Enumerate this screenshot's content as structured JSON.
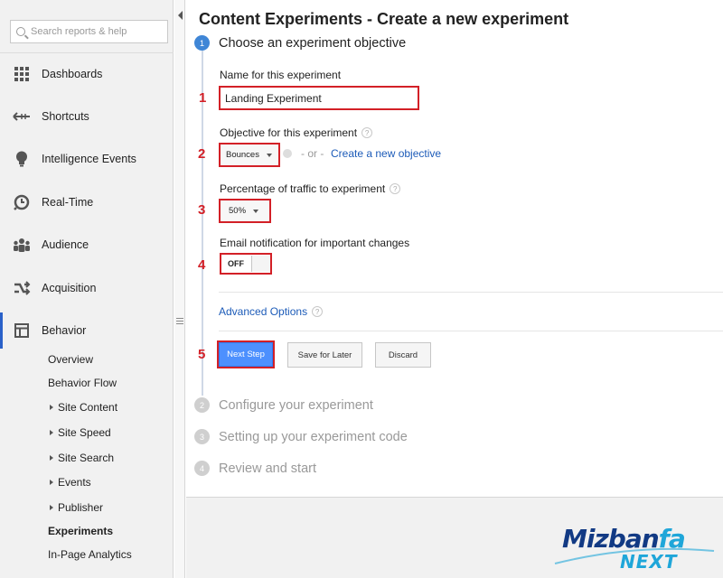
{
  "sidebar": {
    "search_placeholder": "Search reports & help",
    "nav": [
      {
        "label": "Dashboards",
        "icon": "dashboard-grid-icon"
      },
      {
        "label": "Shortcuts",
        "icon": "shortcut-arrow-icon"
      },
      {
        "label": "Intelligence Events",
        "icon": "lightbulb-icon"
      },
      {
        "label": "Real-Time",
        "icon": "realtime-clock-icon"
      },
      {
        "label": "Audience",
        "icon": "audience-people-icon"
      },
      {
        "label": "Acquisition",
        "icon": "acquisition-arrows-icon"
      },
      {
        "label": "Behavior",
        "icon": "behavior-window-icon"
      }
    ],
    "behavior_sub": [
      {
        "label": "Overview"
      },
      {
        "label": "Behavior Flow"
      },
      {
        "label": "Site Content"
      },
      {
        "label": "Site Speed"
      },
      {
        "label": "Site Search"
      },
      {
        "label": "Events"
      },
      {
        "label": "Publisher"
      },
      {
        "label": "Experiments"
      },
      {
        "label": "In-Page Analytics"
      }
    ]
  },
  "main": {
    "title": "Content Experiments - Create a new experiment",
    "steps": [
      {
        "num": "1",
        "title": "Choose an experiment objective"
      },
      {
        "num": "2",
        "title": "Configure your experiment"
      },
      {
        "num": "3",
        "title": "Setting up your experiment code"
      },
      {
        "num": "4",
        "title": "Review and start"
      }
    ],
    "name_label": "Name for this experiment",
    "name_value": "Landing Experiment",
    "objective_label": "Objective for this experiment",
    "objective_value": "Bounces",
    "or_text": "- or -",
    "create_objective": "Create a new objective",
    "traffic_label": "Percentage of traffic to experiment",
    "traffic_value": "50%",
    "email_label": "Email notification for important changes",
    "toggle_value": "OFF",
    "advanced_options": "Advanced Options",
    "help_glyph": "?",
    "buttons": {
      "next": "Next Step",
      "save": "Save for Later",
      "discard": "Discard"
    }
  },
  "annotations": [
    "1",
    "2",
    "3",
    "4",
    "5"
  ],
  "logo": {
    "brand": "Mizban",
    "brand_suffix": "fa",
    "sub": "NEXT"
  },
  "colors": {
    "accent": "#4d90fe",
    "annotation_red": "#d32027",
    "link": "#1c5bb8"
  }
}
